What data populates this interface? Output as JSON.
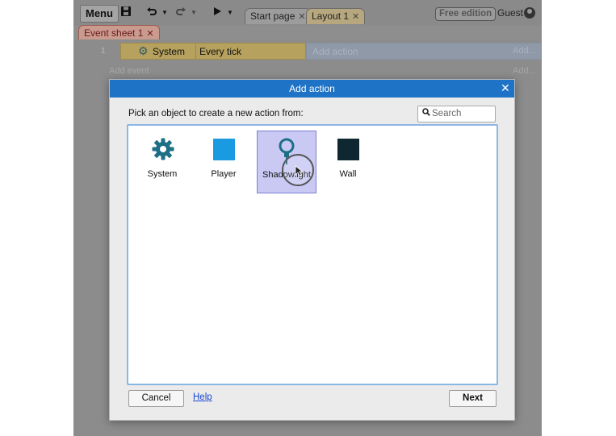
{
  "toolbar": {
    "menu_label": "Menu",
    "save_icon": "save-icon",
    "undo_icon": "undo-icon",
    "redo_icon": "redo-icon",
    "play_icon": "play-icon"
  },
  "tabs": [
    {
      "label": "Start page"
    },
    {
      "label": "Layout 1"
    }
  ],
  "account": {
    "badge": "Free edition",
    "user": "Guest"
  },
  "event_sheet": {
    "tab_label": "Event sheet 1",
    "row_number": "1",
    "condition_object": "System",
    "condition": "Every tick",
    "add_action": "Add action",
    "add_more": "Add...",
    "add_event": "Add event"
  },
  "dialog": {
    "title": "Add action",
    "prompt": "Pick an object to create a new action from:",
    "search_placeholder": "Search",
    "objects": [
      {
        "name": "System",
        "icon": "gear-icon"
      },
      {
        "name": "Player",
        "icon": "sprite-icon",
        "color": "#1a9ae0"
      },
      {
        "name": "Shadowlight",
        "icon": "lightbulb-icon",
        "selected": true
      },
      {
        "name": "Wall",
        "icon": "sprite-icon",
        "color": "#0e2730"
      }
    ],
    "cancel_label": "Cancel",
    "help_label": "Help",
    "next_label": "Next"
  },
  "colors": {
    "accent": "#1e73c7",
    "selection": "#c9c9f4",
    "event_condition": "#b6a15e"
  }
}
